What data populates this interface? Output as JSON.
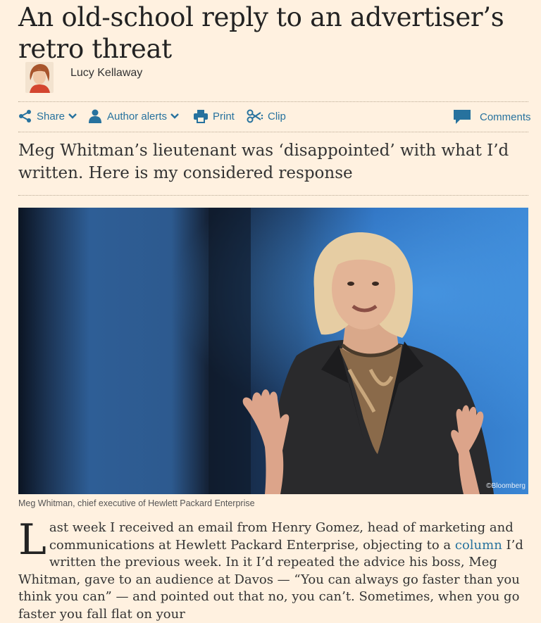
{
  "article": {
    "headline": "An old-school reply to an advertiser’s retro threat",
    "author": "Lucy Kellaway",
    "standfirst": "Meg Whitman’s lieutenant was ‘disappointed’ with what I’d written. Here is my considered response"
  },
  "toolbar": {
    "share": "Share",
    "author_alerts": "Author alerts",
    "print": "Print",
    "clip": "Clip",
    "comments": "Comments"
  },
  "image": {
    "credit": "©Bloomberg",
    "caption": "Meg Whitman, chief executive of Hewlett Packard Enterprise"
  },
  "body": {
    "dropcap": "L",
    "text_before_link": "ast week I received an email from Henry Gomez, head of marketing and communications at Hewlett Packard Enterprise, objecting to a ",
    "link": "column",
    "text_after_link": " I’d written the previous week. In it I’d repeated the advice his boss, Meg Whitman, gave to an audience at Davos — “You can always go faster than you think you can” — and pointed out that no, you can’t. Sometimes, when you go faster you fall flat on your"
  },
  "colors": {
    "background": "#fff1e0",
    "link": "#27729e",
    "text": "#333333"
  }
}
